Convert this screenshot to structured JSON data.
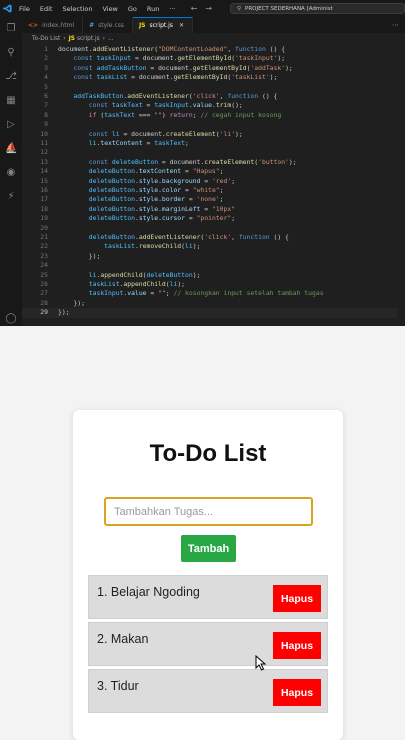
{
  "menubar": {
    "items": [
      "File",
      "Edit",
      "Selection",
      "View",
      "Go",
      "Run",
      "···"
    ],
    "search_text": "PROJECT SEDERHANA [Administ"
  },
  "tabs": [
    {
      "label": "index.html",
      "type": "html",
      "active": false
    },
    {
      "label": "style.css",
      "type": "css",
      "active": false
    },
    {
      "label": "script.js",
      "type": "js",
      "active": true
    }
  ],
  "breadcrumb": {
    "folder": "To-Do List",
    "file": "script.js",
    "rest": "..."
  },
  "code_lines": [
    {
      "n": "1",
      "html": "document.<span class='fn'>addEventListener</span>(<span class='str'>\"DOMContentLoaded\"</span>, <span class='kw'>function</span> () {"
    },
    {
      "n": "2",
      "html": "    <span class='kw'>const</span> <span class='cst'>taskInput</span> = document.<span class='fn'>getElementById</span>(<span class='str'>'taskInput'</span>);"
    },
    {
      "n": "3",
      "html": "    <span class='kw'>const</span> <span class='cst'>addTaskButton</span> = document.<span class='fn'>getElementById</span>(<span class='str'>'addTask'</span>);"
    },
    {
      "n": "4",
      "html": "    <span class='kw'>const</span> <span class='cst'>taskList</span> = document.<span class='fn'>getElementById</span>(<span class='str'>'taskList'</span>);"
    },
    {
      "n": "5",
      "html": ""
    },
    {
      "n": "6",
      "html": "    <span class='cst'>addTaskButton</span>.<span class='fn'>addEventListener</span>(<span class='str'>'click'</span>, <span class='kw'>function</span> () {"
    },
    {
      "n": "7",
      "html": "        <span class='kw'>const</span> <span class='cst'>taskText</span> = <span class='cst'>taskInput</span>.<span class='obj'>value</span>.<span class='fn'>trim</span>();"
    },
    {
      "n": "8",
      "html": "        <span class='ctl'>if</span> (<span class='cst'>taskText</span> === <span class='str'>\"\"</span>) <span class='ctl'>return</span>; <span class='cmt'>// cegah input kosong</span>"
    },
    {
      "n": "9",
      "html": ""
    },
    {
      "n": "10",
      "html": "        <span class='kw'>const</span> <span class='cst'>li</span> = document.<span class='fn'>createElement</span>(<span class='str'>'li'</span>);"
    },
    {
      "n": "11",
      "html": "        <span class='cst'>li</span>.<span class='obj'>textContent</span> = <span class='cst'>taskText</span>;"
    },
    {
      "n": "12",
      "html": ""
    },
    {
      "n": "13",
      "html": "        <span class='kw'>const</span> <span class='cst'>deleteButton</span> = document.<span class='fn'>createElement</span>(<span class='str'>'button'</span>);"
    },
    {
      "n": "14",
      "html": "        <span class='cst'>deleteButton</span>.<span class='obj'>textContent</span> = <span class='str'>\"Hapus\"</span>;"
    },
    {
      "n": "15",
      "html": "        <span class='cst'>deleteButton</span>.<span class='obj'>style</span>.<span class='obj'>background</span> = <span class='str'>'red'</span>;"
    },
    {
      "n": "16",
      "html": "        <span class='cst'>deleteButton</span>.<span class='obj'>style</span>.<span class='obj'>color</span> = <span class='str'>\"white\"</span>;"
    },
    {
      "n": "17",
      "html": "        <span class='cst'>deleteButton</span>.<span class='obj'>style</span>.<span class='obj'>border</span> = <span class='str'>'none'</span>;"
    },
    {
      "n": "18",
      "html": "        <span class='cst'>deleteButton</span>.<span class='obj'>style</span>.<span class='obj'>marginLeft</span> = <span class='str'>\"10px\"</span>"
    },
    {
      "n": "19",
      "html": "        <span class='cst'>deleteButton</span>.<span class='obj'>style</span>.<span class='obj'>cursor</span> = <span class='str'>\"pointer\"</span>;"
    },
    {
      "n": "20",
      "html": ""
    },
    {
      "n": "21",
      "html": "        <span class='cst'>deleteButton</span>.<span class='fn'>addEventListener</span>(<span class='str'>'click'</span>, <span class='kw'>function</span> () {"
    },
    {
      "n": "22",
      "html": "            <span class='cst'>taskList</span>.<span class='fn'>removeChild</span>(<span class='cst'>li</span>);"
    },
    {
      "n": "23",
      "html": "        });"
    },
    {
      "n": "24",
      "html": ""
    },
    {
      "n": "25",
      "html": "        <span class='cst'>li</span>.<span class='fn'>appendChild</span>(<span class='cst'>deleteButton</span>);"
    },
    {
      "n": "26",
      "html": "        <span class='cst'>taskList</span>.<span class='fn'>appendChild</span>(<span class='cst'>li</span>);"
    },
    {
      "n": "27",
      "html": "        <span class='cst'>taskInput</span>.<span class='obj'>value</span> = <span class='str'>\"\"</span>; <span class='cmt'>// kosongkan input setelah tambah tugas</span>"
    },
    {
      "n": "28",
      "html": "    });"
    },
    {
      "n": "29",
      "html": "});"
    }
  ],
  "app": {
    "title": "To-Do List",
    "input_placeholder": "Tambahkan Tugas...",
    "add_label": "Tambah",
    "tasks": [
      {
        "text": "1. Belajar Ngoding",
        "delete_label": "Hapus"
      },
      {
        "text": "2. Makan",
        "delete_label": "Hapus"
      },
      {
        "text": "3. Tidur",
        "delete_label": "Hapus"
      }
    ]
  },
  "colors": {
    "editor_bg": "#1f1f1f",
    "add_button": "#28a745",
    "delete_button": "#ff0000",
    "input_border": "#d9a520"
  }
}
